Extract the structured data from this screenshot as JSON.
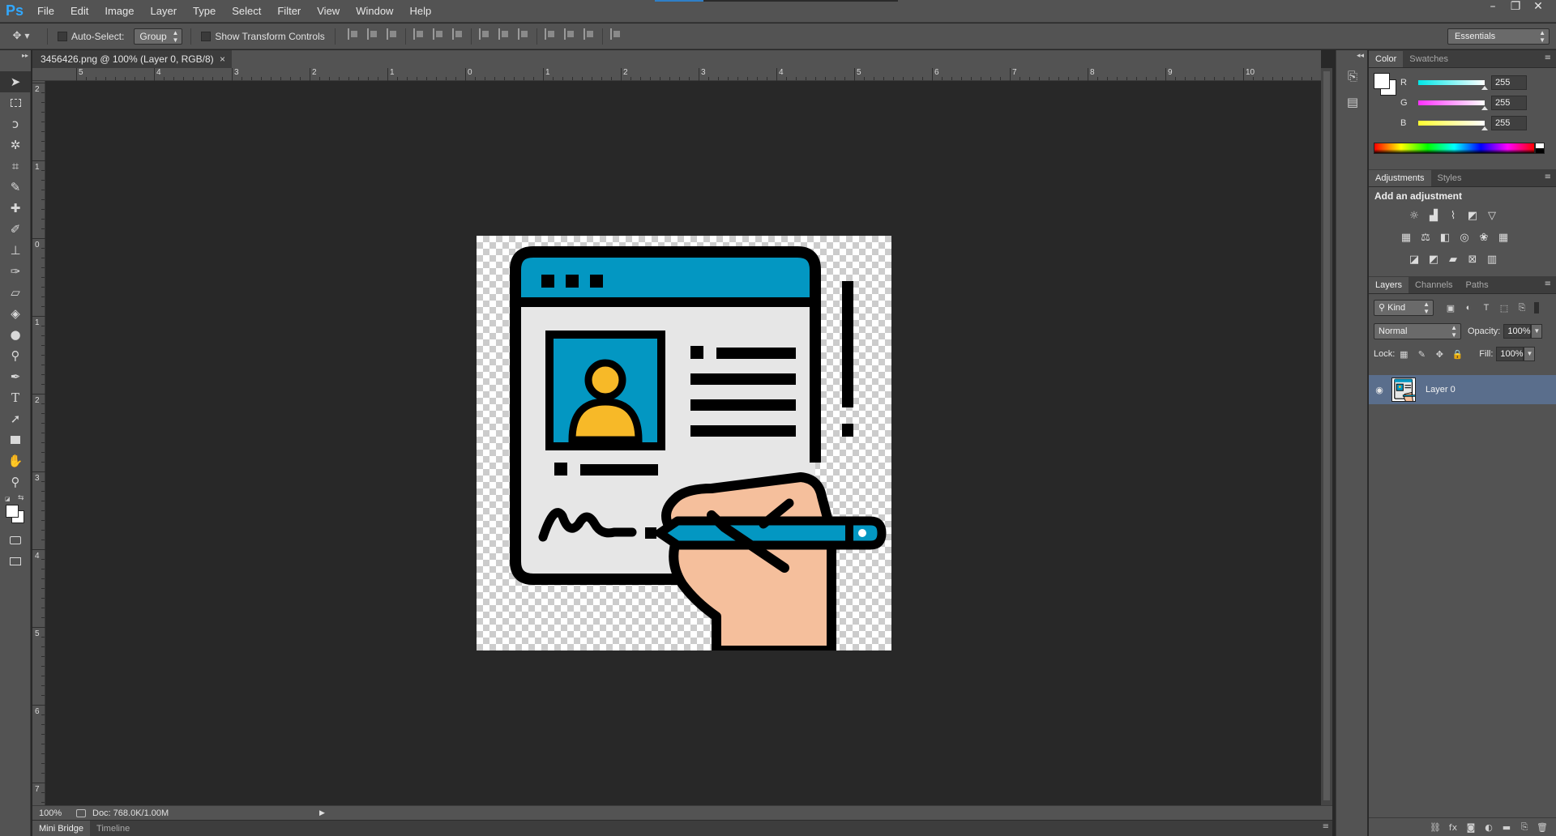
{
  "app": {
    "logo": "Ps"
  },
  "menu": [
    "File",
    "Edit",
    "Image",
    "Layer",
    "Type",
    "Select",
    "Filter",
    "View",
    "Window",
    "Help"
  ],
  "window_controls": {
    "minimize": "–",
    "restore": "❐",
    "close": "✕"
  },
  "options_bar": {
    "auto_select_label": "Auto-Select:",
    "auto_select_value": "Group",
    "show_transform_label": "Show Transform Controls",
    "workspace": "Essentials"
  },
  "document": {
    "tab_title": "3456426.png @ 100% (Layer 0, RGB/8)",
    "close_glyph": "×",
    "zoom": "100%",
    "doc_info": "Doc: 768.0K/1.00M"
  },
  "rulers": {
    "h_labels": [
      "5",
      "4",
      "3",
      "2",
      "1",
      "0",
      "1",
      "2",
      "3",
      "4",
      "5",
      "6",
      "7",
      "8",
      "9",
      "10"
    ],
    "v_labels": [
      "2",
      "1",
      "0",
      "1",
      "2",
      "3",
      "4",
      "5",
      "6",
      "7"
    ]
  },
  "bottom_tabs": [
    "Mini Bridge",
    "Timeline"
  ],
  "color_panel": {
    "tabs": [
      "Color",
      "Swatches"
    ],
    "channels": [
      {
        "label": "R",
        "value": "255",
        "color": "#00e0e0"
      },
      {
        "label": "G",
        "value": "255",
        "color": "#ff40ff"
      },
      {
        "label": "B",
        "value": "255",
        "color": "#ffff40"
      }
    ],
    "foreground": "#ffffff",
    "background": "#ffffff"
  },
  "adjustments_panel": {
    "tabs": [
      "Adjustments",
      "Styles"
    ],
    "title": "Add an adjustment"
  },
  "layers_panel": {
    "tabs": [
      "Layers",
      "Channels",
      "Paths"
    ],
    "kind_label": "Kind",
    "blend_mode": "Normal",
    "opacity_label": "Opacity:",
    "opacity_value": "100%",
    "lock_label": "Lock:",
    "fill_label": "Fill:",
    "fill_value": "100%",
    "layers": [
      {
        "name": "Layer 0",
        "visible": true,
        "selected": true
      }
    ]
  },
  "colors": {
    "icon_blue": "#0397c2",
    "icon_yellow": "#f7b928",
    "icon_skin": "#f5bf9c",
    "icon_paper": "#e6e6e6",
    "icon_outline": "#000000"
  }
}
